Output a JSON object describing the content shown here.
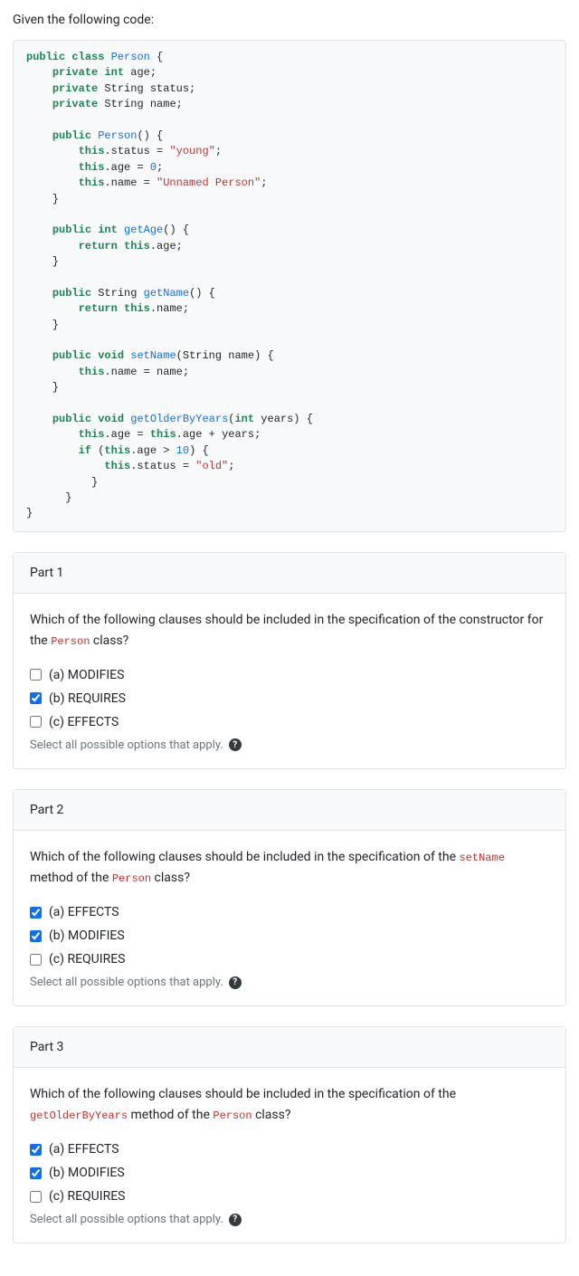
{
  "intro": "Given the following code:",
  "code_tokens": [
    [
      "kw",
      "public"
    ],
    [
      "pl",
      " "
    ],
    [
      "kw",
      "class"
    ],
    [
      "pl",
      " "
    ],
    [
      "cls",
      "Person"
    ],
    [
      "pl",
      " {"
    ],
    [
      "nl",
      ""
    ],
    [
      "pl",
      "    "
    ],
    [
      "kw",
      "private"
    ],
    [
      "pl",
      " "
    ],
    [
      "kw",
      "int"
    ],
    [
      "pl",
      " age;"
    ],
    [
      "nl",
      ""
    ],
    [
      "pl",
      "    "
    ],
    [
      "kw",
      "private"
    ],
    [
      "pl",
      " String status;"
    ],
    [
      "nl",
      ""
    ],
    [
      "pl",
      "    "
    ],
    [
      "kw",
      "private"
    ],
    [
      "pl",
      " String name;"
    ],
    [
      "nl",
      ""
    ],
    [
      "nl",
      ""
    ],
    [
      "pl",
      "    "
    ],
    [
      "kw",
      "public"
    ],
    [
      "pl",
      " "
    ],
    [
      "mth",
      "Person"
    ],
    [
      "pl",
      "() {"
    ],
    [
      "nl",
      ""
    ],
    [
      "pl",
      "        "
    ],
    [
      "kw",
      "this"
    ],
    [
      "pl",
      ".status = "
    ],
    [
      "str",
      "\"young\""
    ],
    [
      "pl",
      ";"
    ],
    [
      "nl",
      ""
    ],
    [
      "pl",
      "        "
    ],
    [
      "kw",
      "this"
    ],
    [
      "pl",
      ".age = "
    ],
    [
      "num",
      "0"
    ],
    [
      "pl",
      ";"
    ],
    [
      "nl",
      ""
    ],
    [
      "pl",
      "        "
    ],
    [
      "kw",
      "this"
    ],
    [
      "pl",
      ".name = "
    ],
    [
      "str",
      "\"Unnamed Person\""
    ],
    [
      "pl",
      ";"
    ],
    [
      "nl",
      ""
    ],
    [
      "pl",
      "    }"
    ],
    [
      "nl",
      ""
    ],
    [
      "nl",
      ""
    ],
    [
      "pl",
      "    "
    ],
    [
      "kw",
      "public"
    ],
    [
      "pl",
      " "
    ],
    [
      "kw",
      "int"
    ],
    [
      "pl",
      " "
    ],
    [
      "mth",
      "getAge"
    ],
    [
      "pl",
      "() {"
    ],
    [
      "nl",
      ""
    ],
    [
      "pl",
      "        "
    ],
    [
      "kw",
      "return"
    ],
    [
      "pl",
      " "
    ],
    [
      "kw",
      "this"
    ],
    [
      "pl",
      ".age;"
    ],
    [
      "nl",
      ""
    ],
    [
      "pl",
      "    }"
    ],
    [
      "nl",
      ""
    ],
    [
      "nl",
      ""
    ],
    [
      "pl",
      "    "
    ],
    [
      "kw",
      "public"
    ],
    [
      "pl",
      " String "
    ],
    [
      "mth",
      "getName"
    ],
    [
      "pl",
      "() {"
    ],
    [
      "nl",
      ""
    ],
    [
      "pl",
      "        "
    ],
    [
      "kw",
      "return"
    ],
    [
      "pl",
      " "
    ],
    [
      "kw",
      "this"
    ],
    [
      "pl",
      ".name;"
    ],
    [
      "nl",
      ""
    ],
    [
      "pl",
      "    }"
    ],
    [
      "nl",
      ""
    ],
    [
      "nl",
      ""
    ],
    [
      "pl",
      "    "
    ],
    [
      "kw",
      "public"
    ],
    [
      "pl",
      " "
    ],
    [
      "kw",
      "void"
    ],
    [
      "pl",
      " "
    ],
    [
      "mth",
      "setName"
    ],
    [
      "pl",
      "(String name) {"
    ],
    [
      "nl",
      ""
    ],
    [
      "pl",
      "        "
    ],
    [
      "kw",
      "this"
    ],
    [
      "pl",
      ".name = name;"
    ],
    [
      "nl",
      ""
    ],
    [
      "pl",
      "    }"
    ],
    [
      "nl",
      ""
    ],
    [
      "nl",
      ""
    ],
    [
      "pl",
      "    "
    ],
    [
      "kw",
      "public"
    ],
    [
      "pl",
      " "
    ],
    [
      "kw",
      "void"
    ],
    [
      "pl",
      " "
    ],
    [
      "mth",
      "getOlderByYears"
    ],
    [
      "pl",
      "("
    ],
    [
      "kw",
      "int"
    ],
    [
      "pl",
      " years) {"
    ],
    [
      "nl",
      ""
    ],
    [
      "pl",
      "        "
    ],
    [
      "kw",
      "this"
    ],
    [
      "pl",
      ".age = "
    ],
    [
      "kw",
      "this"
    ],
    [
      "pl",
      ".age + years;"
    ],
    [
      "nl",
      ""
    ],
    [
      "pl",
      "        "
    ],
    [
      "kw",
      "if"
    ],
    [
      "pl",
      " ("
    ],
    [
      "kw",
      "this"
    ],
    [
      "pl",
      ".age > "
    ],
    [
      "num",
      "10"
    ],
    [
      "pl",
      ") {"
    ],
    [
      "nl",
      ""
    ],
    [
      "pl",
      "            "
    ],
    [
      "kw",
      "this"
    ],
    [
      "pl",
      ".status = "
    ],
    [
      "str",
      "\"old\""
    ],
    [
      "pl",
      ";"
    ],
    [
      "nl",
      ""
    ],
    [
      "pl",
      "          }"
    ],
    [
      "nl",
      ""
    ],
    [
      "pl",
      "      }"
    ],
    [
      "nl",
      ""
    ],
    [
      "pl",
      "}"
    ]
  ],
  "hint_text": "Select all possible options that apply.",
  "parts": [
    {
      "title": "Part 1",
      "question_pre": "Which of the following clauses should be included in the specification of the constructor for the ",
      "question_code": "Person",
      "question_post": " class?",
      "options": [
        {
          "label": "(a) MODIFIES",
          "checked": false
        },
        {
          "label": "(b) REQUIRES",
          "checked": true
        },
        {
          "label": "(c) EFFECTS",
          "checked": false
        }
      ]
    },
    {
      "title": "Part 2",
      "question_pre": "Which of the following clauses should be included in the specification of the ",
      "question_code": "setName",
      "question_post": " method of the ",
      "question_code2": "Person",
      "question_post2": " class?",
      "options": [
        {
          "label": "(a) EFFECTS",
          "checked": true
        },
        {
          "label": "(b) MODIFIES",
          "checked": true
        },
        {
          "label": "(c) REQUIRES",
          "checked": false
        }
      ]
    },
    {
      "title": "Part 3",
      "question_pre": "Which of the following clauses should be included in the specification of the ",
      "question_code": "getOlderByYears",
      "question_post": " method of the ",
      "question_code2": "Person",
      "question_post2": " class?",
      "options": [
        {
          "label": "(a) EFFECTS",
          "checked": true
        },
        {
          "label": "(b) MODIFIES",
          "checked": true
        },
        {
          "label": "(c) REQUIRES",
          "checked": false
        }
      ]
    }
  ]
}
